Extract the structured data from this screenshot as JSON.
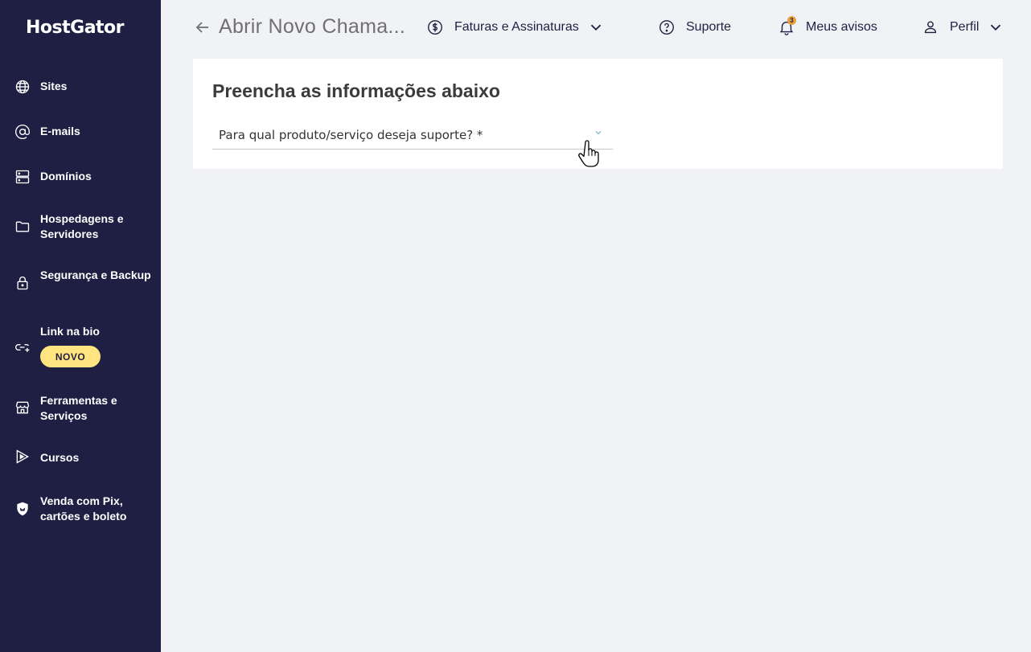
{
  "brand": {
    "name": "HostGator"
  },
  "sidebar": {
    "items": [
      {
        "label": "Sites",
        "icon": "globe-icon"
      },
      {
        "label": "E-mails",
        "icon": "at-sign-icon"
      },
      {
        "label": "Domínios",
        "icon": "server-icon"
      },
      {
        "label": "Hospedagens e Servidores",
        "icon": "folder-icon"
      },
      {
        "label": "Segurança e Backup",
        "icon": "lock-icon"
      },
      {
        "label": "Link na bio",
        "icon": "link-plus-icon",
        "badge": "NOVO"
      },
      {
        "label": "Ferramentas e Serviços",
        "icon": "storefront-icon"
      },
      {
        "label": "Cursos",
        "icon": "play-icon"
      },
      {
        "label": "Venda com Pix, cartões e boleto",
        "icon": "shield-icon"
      }
    ]
  },
  "header": {
    "title": "Abrir Novo Chama...",
    "billing": "Faturas e Assinaturas",
    "support": "Suporte",
    "notifications": {
      "label": "Meus avisos",
      "count": "3"
    },
    "profile": "Perfil"
  },
  "form": {
    "heading": "Preencha as informações abaixo",
    "product_select_label": "Para qual produto/serviço deseja suporte? *"
  },
  "colors": {
    "sidebar_bg": "#1f1f43",
    "badge_bg": "#ffe47f",
    "notification_dot": "#e8a23b",
    "page_bg": "#f1f2f6"
  }
}
